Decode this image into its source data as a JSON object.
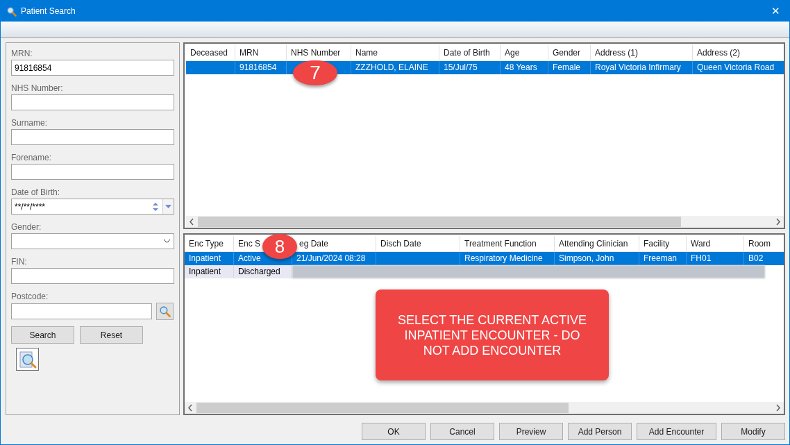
{
  "window": {
    "title": "Patient Search",
    "close": "✕"
  },
  "search_form": {
    "fields": [
      {
        "kind": "text",
        "label": "MRN:",
        "value": "91816854"
      },
      {
        "kind": "text",
        "label": "NHS Number:"
      },
      {
        "kind": "text",
        "label": "Surname:"
      },
      {
        "kind": "text",
        "label": "Forename:"
      },
      {
        "kind": "date",
        "label": "Date of Birth:",
        "value": "**/**/****"
      },
      {
        "kind": "select",
        "label": "Gender:"
      },
      {
        "kind": "text",
        "label": "FIN:"
      },
      {
        "kind": "lookup",
        "label": "Postcode:"
      }
    ],
    "buttons": [
      "Search",
      "Reset"
    ]
  },
  "patients": {
    "columns": [
      "Deceased",
      "MRN",
      "NHS Number",
      "Name",
      "Date of Birth",
      "Age",
      "Gender",
      "Address (1)",
      "Address (2)"
    ],
    "rows": [
      {
        "selected": true,
        "cells": [
          "",
          "91816854",
          "",
          "ZZZHOLD, ELAINE",
          "15/Jul/75",
          "48 Years",
          "Female",
          "Royal Victoria Infirmary",
          "Queen Victoria Road"
        ]
      }
    ]
  },
  "encounters": {
    "columns": [
      "Enc Type",
      "Enc S",
      "eg Date",
      "Disch Date",
      "Treatment Function",
      "Attending Clinician",
      "Facility",
      "Ward",
      "Room"
    ],
    "rows": [
      {
        "selected": true,
        "redacted": false,
        "cells": [
          "Inpatient",
          "Active",
          "21/Jun/2024 08:28",
          "",
          "Respiratory Medicine",
          "Simpson, John",
          "Freeman",
          "FH01",
          "B02"
        ]
      },
      {
        "selected": false,
        "redacted": true,
        "cells": [
          "Inpatient",
          "Discharged"
        ]
      }
    ]
  },
  "annotations": {
    "badges": [
      "7",
      "8"
    ],
    "callout": "SELECT THE CURRENT ACTIVE INPATIENT ENCOUNTER - DO NOT ADD ENCOUNTER"
  },
  "buttons": [
    "OK",
    "Cancel",
    "Preview",
    "Add Person",
    "Add Encounter",
    "Modify"
  ]
}
